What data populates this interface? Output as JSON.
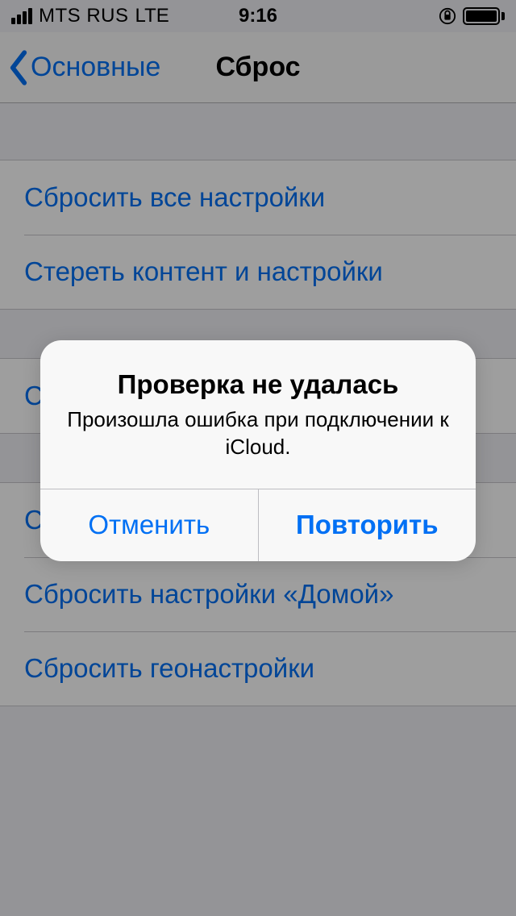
{
  "status_bar": {
    "carrier": "MTS RUS",
    "connection": "LTE",
    "time": "9:16"
  },
  "nav": {
    "back_label": "Основные",
    "title": "Сброс"
  },
  "groups": [
    {
      "items": [
        {
          "label": "Сбросить все настройки"
        },
        {
          "label": "Стереть контент и настройки"
        }
      ]
    },
    {
      "items": [
        {
          "label": "Сбросить настройки сети"
        }
      ]
    },
    {
      "items": [
        {
          "label": "Сбросить словарь клавиатуры"
        },
        {
          "label": "Сбросить настройки «Домой»"
        },
        {
          "label": "Сбросить геонастройки"
        }
      ]
    }
  ],
  "alert": {
    "title": "Проверка не удалась",
    "message": "Произошла ошибка при подключении к iCloud.",
    "cancel": "Отменить",
    "retry": "Повторить"
  }
}
